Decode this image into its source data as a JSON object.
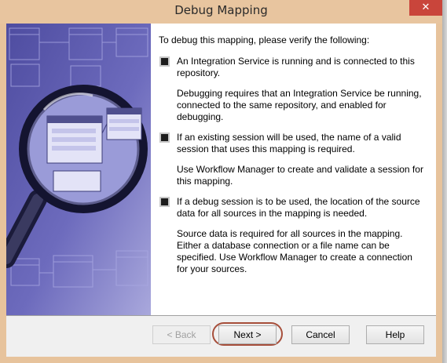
{
  "window": {
    "title": "Debug Mapping",
    "close_label": "✕"
  },
  "content": {
    "intro": "To debug this mapping, please verify the following:",
    "items": [
      {
        "title": "An Integration Service is running and is connected to this repository.",
        "detail": "Debugging requires that an Integration Service be running, connected to the same repository, and enabled for debugging."
      },
      {
        "title": "If an existing session will be used, the name of a valid session that uses this mapping is required.",
        "detail": "Use Workflow Manager to create and validate a session for this mapping."
      },
      {
        "title": "If a debug session is to be used, the location of the source data for all sources in the mapping is needed.",
        "detail": "Source data is required for all sources in the mapping. Either a database connection or a file name can be specified. Use Workflow Manager to create a connection for your sources."
      }
    ]
  },
  "buttons": {
    "back": "< Back",
    "next": "Next >",
    "cancel": "Cancel",
    "help": "Help"
  },
  "colors": {
    "art_background": "#6c6ab8",
    "highlight_ring": "#a64e3a"
  }
}
